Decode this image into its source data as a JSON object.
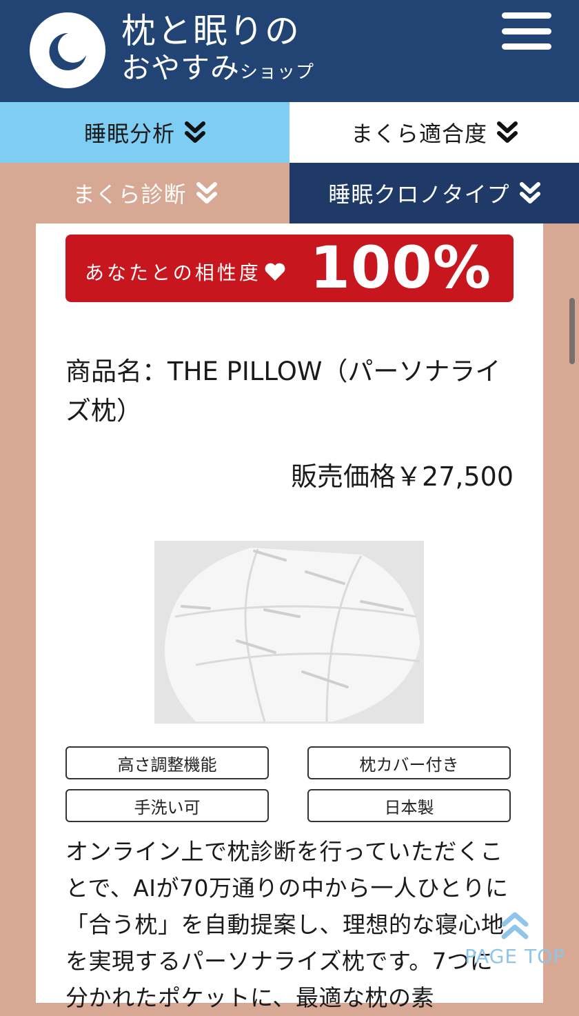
{
  "header": {
    "logo_title": "枕と眠りの",
    "logo_subtitle_main": "おやすみ",
    "logo_subtitle_small": "ショップ",
    "logo_icon": "moon-icon",
    "menu_icon": "hamburger-menu-icon"
  },
  "nav": [
    {
      "label": "睡眠分析"
    },
    {
      "label": "まくら適合度"
    },
    {
      "label": "まくら診断"
    },
    {
      "label": "睡眠クロノタイプ"
    }
  ],
  "match": {
    "label": "あなたとの相性度",
    "value": "100%",
    "icon": "heart-icon",
    "color": "#c8161e"
  },
  "product": {
    "name": "商品名：THE PILLOW（パーソナライズ枕）",
    "price": "販売価格￥27,500",
    "image_alt": "pillow-image",
    "tags": [
      "高さ調整機能",
      "枕カバー付き",
      "手洗い可",
      "日本製"
    ],
    "description": "オンライン上で枕診断を行っていただくことで、AIが70万通りの中から一人ひとりに「合う枕」を自動提案し、理想的な寝心地を実現するパーソナライズ枕です。7つに分かれたポケットに、最適な枕の素"
  },
  "page_top": {
    "label": "PAGE TOP",
    "icon": "double-chevron-up-icon"
  },
  "colors": {
    "header_bg": "#214474",
    "nav_light_blue": "#7ecdf2",
    "nav_tan": "#d7a893",
    "nav_navy": "#1f3a66",
    "page_top": "#8ec5e8"
  }
}
